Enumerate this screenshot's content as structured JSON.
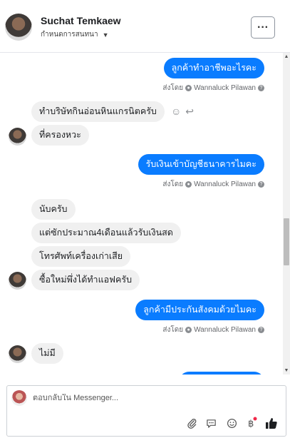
{
  "header": {
    "name": "Suchat Temkaew",
    "subtitle": "กำหนดการสนทนา",
    "more_label": "···"
  },
  "sent_by_label": "ส่งโดย",
  "agent_name": "Wannaluck Pilawan",
  "messages": {
    "out_1": "ลูกค้าทำอาชีพอะไรคะ",
    "in_1": "ทำบริษัทกินอ่อนหินแกรนิตครับ",
    "in_2": "ที่ครองหวะ",
    "out_2": "รับเงินเข้าบัญชีธนาคารไมคะ",
    "in_3": "นับครับ",
    "in_4": "แต่ซักประมาณ4เดือนแล้วรับเงินสด",
    "in_5": "โทรศัพท์เครื่องเก่าเสีย",
    "in_6": "ซื้อใหม่พึ่งได้ทำแอฟครับ",
    "out_3": "ลูกค้ามีประกันสังคมด้วยไมคะ",
    "in_7": "ไม่มี"
  },
  "composer": {
    "placeholder": "ตอบกลับใน Messenger..."
  },
  "icons": {
    "attach": "paperclip-icon",
    "saved_replies": "chat-bubble-icon",
    "emoji": "smiley-icon",
    "payment": "baht-icon",
    "like": "thumbs-up-icon"
  },
  "colors": {
    "outgoing_bubble": "#0a7cff",
    "incoming_bubble": "#f0f0f0",
    "like_icon": "#1c1e21",
    "notification_dot": "#f02849"
  }
}
